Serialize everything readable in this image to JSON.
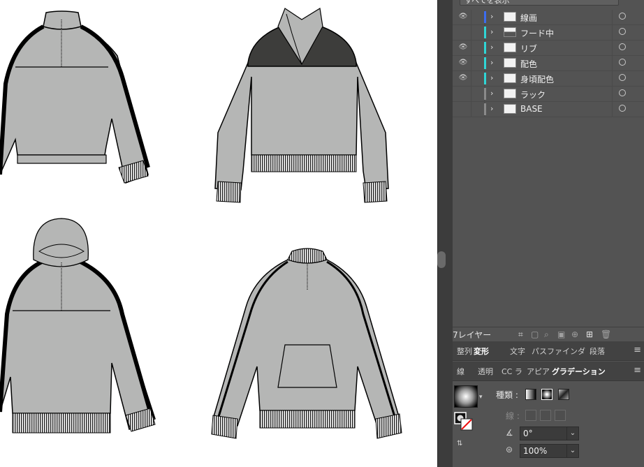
{
  "layers_panel": {
    "search_field": "すべてを表示",
    "layers": [
      {
        "name": "線画",
        "visible": true,
        "color": "#3c6cf0",
        "thumb": "pattern"
      },
      {
        "name": "フード中",
        "visible": false,
        "color": "#2fd6d6",
        "thumb": "dark"
      },
      {
        "name": "リブ",
        "visible": true,
        "color": "#2fd6d6",
        "thumb": "light"
      },
      {
        "name": "配色",
        "visible": true,
        "color": "#2fd6d6",
        "thumb": "light"
      },
      {
        "name": "身頃配色",
        "visible": true,
        "color": "#2fd6d6",
        "thumb": "pattern"
      },
      {
        "name": "ラック",
        "visible": false,
        "color": "#8a8a8a",
        "thumb": "light"
      },
      {
        "name": "BASE",
        "visible": false,
        "color": "#8a8a8a",
        "thumb": "light"
      }
    ],
    "layer_count": "7レイヤー",
    "footer_icons": [
      "collect-export-icon",
      "make-clipping-mask-icon",
      "locate-object-icon",
      "new-sublayer-icon",
      "move-selection-icon",
      "new-layer-icon",
      "trash-icon"
    ]
  },
  "tabs_row1": {
    "items": [
      "整列",
      "変形",
      "文字",
      "パスファインダ",
      "段落"
    ],
    "active": "変形"
  },
  "tabs_row2": {
    "items": [
      "線",
      "透明",
      "CC ラ",
      "アピア",
      "グラデーション"
    ],
    "active": "グラデーション"
  },
  "gradient_panel": {
    "type_label": "種類 :",
    "stroke_label": "線 :",
    "angle_value": "0°",
    "aspect_value": "100%"
  },
  "colors": {
    "canvas_bg": "#ffffff",
    "panel_bg": "#535353",
    "garment_fill": "#b5b6b5",
    "garment_dark": "#3d3d3b",
    "stripe": "#000000"
  }
}
